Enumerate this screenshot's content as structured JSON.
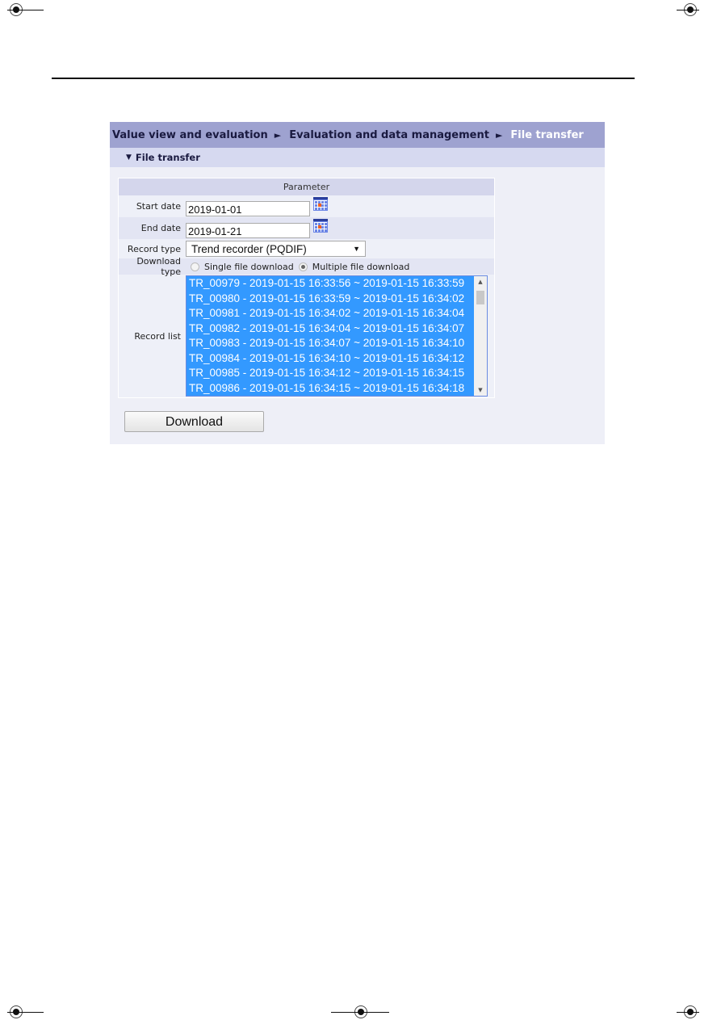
{
  "breadcrumb": {
    "items": [
      "Value view and evaluation",
      "Evaluation and data management",
      "File transfer"
    ],
    "separator": "►"
  },
  "section": {
    "toggle": "▼",
    "title": "File transfer"
  },
  "parameter": {
    "header": "Parameter",
    "start_date": {
      "label": "Start date",
      "value": "2019-01-01",
      "icon": "calendar-icon"
    },
    "end_date": {
      "label": "End date",
      "value": "2019-01-21",
      "icon": "calendar-icon"
    },
    "record_type": {
      "label": "Record type",
      "value": "Trend recorder (PQDIF)",
      "arrow": "▼"
    },
    "download_type": {
      "label": "Download type",
      "options": [
        {
          "label": "Single file download",
          "checked": false
        },
        {
          "label": "Multiple file download",
          "checked": true
        }
      ]
    },
    "record_list": {
      "label": "Record list",
      "items": [
        "TR_00979 - 2019-01-15 16:33:56 ~ 2019-01-15 16:33:59",
        "TR_00980 - 2019-01-15 16:33:59 ~ 2019-01-15 16:34:02",
        "TR_00981 - 2019-01-15 16:34:02 ~ 2019-01-15 16:34:04",
        "TR_00982 - 2019-01-15 16:34:04 ~ 2019-01-15 16:34:07",
        "TR_00983 - 2019-01-15 16:34:07 ~ 2019-01-15 16:34:10",
        "TR_00984 - 2019-01-15 16:34:10 ~ 2019-01-15 16:34:12",
        "TR_00985 - 2019-01-15 16:34:12 ~ 2019-01-15 16:34:15",
        "TR_00986 - 2019-01-15 16:34:15 ~ 2019-01-15 16:34:18"
      ],
      "scroll_up": "▲",
      "scroll_down": "▼"
    }
  },
  "actions": {
    "download_label": "Download"
  },
  "colors": {
    "breadcrumb_bg": "#9ea2d0",
    "subheader_bg": "#d6d9f0",
    "panel_bg": "#eeeff7",
    "selection": "#3399ff"
  }
}
